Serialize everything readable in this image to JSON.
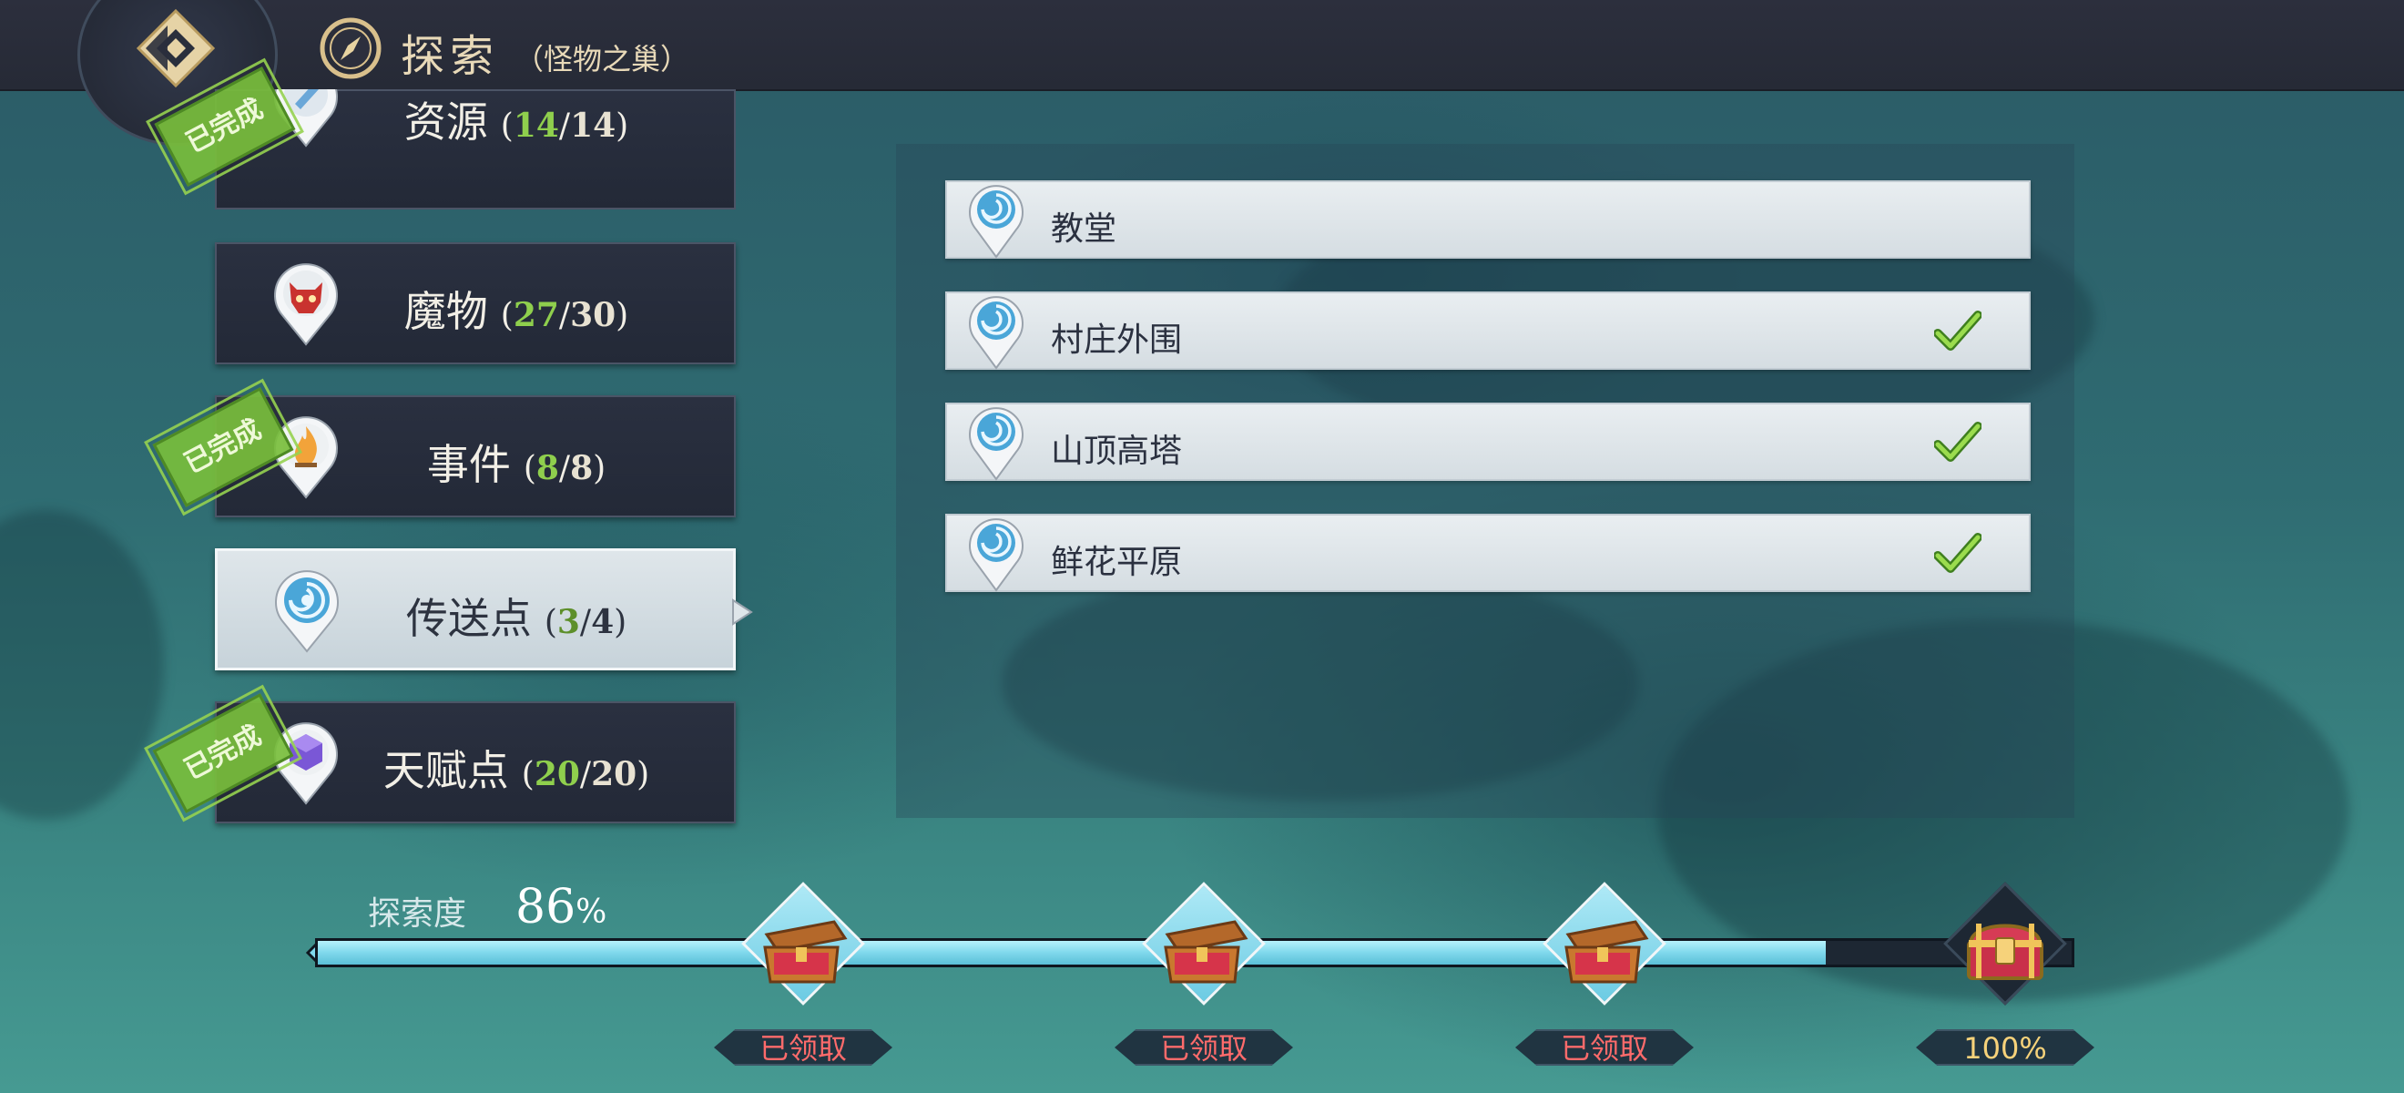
{
  "header": {
    "title": "探索",
    "subtitle": "（怪物之巢）"
  },
  "categories": [
    {
      "name": "资源",
      "found": "14",
      "total": "14",
      "icon": "resource-icon",
      "completed": true
    },
    {
      "name": "魔物",
      "found": "27",
      "total": "30",
      "icon": "monster-icon",
      "completed": false
    },
    {
      "name": "事件",
      "found": "8",
      "total": "8",
      "icon": "event-fire-icon",
      "completed": true
    },
    {
      "name": "传送点",
      "found": "3",
      "total": "4",
      "icon": "teleport-icon",
      "completed": false,
      "selected": true
    },
    {
      "name": "天赋点",
      "found": "20",
      "total": "20",
      "icon": "talent-cube-icon",
      "completed": true
    }
  ],
  "stamp_text": "已完成",
  "waypoints": [
    {
      "name": "教堂",
      "checked": false
    },
    {
      "name": "村庄外围",
      "checked": true
    },
    {
      "name": "山顶高塔",
      "checked": true
    },
    {
      "name": "鲜花平原",
      "checked": true
    }
  ],
  "progress": {
    "label": "探索度",
    "value": "86",
    "unit": "%",
    "fraction": 0.86,
    "rewards": [
      {
        "label": "已领取",
        "claimed": true
      },
      {
        "label": "已领取",
        "claimed": true
      },
      {
        "label": "已领取",
        "claimed": true
      },
      {
        "label": "100%",
        "claimed": false
      }
    ]
  },
  "colors": {
    "accent_green": "#8fcf4d",
    "claimed_red": "#ff6b6b",
    "gold": "#f6d27a",
    "header_text": "#e8d9b8"
  }
}
